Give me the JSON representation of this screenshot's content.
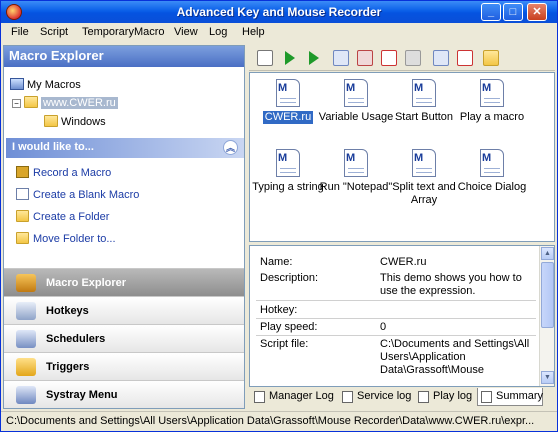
{
  "window": {
    "title": "Advanced Key and Mouse Recorder"
  },
  "menu": [
    "File",
    "Script",
    "TemporaryMacro",
    "View",
    "Log",
    "Help"
  ],
  "explorer": {
    "title": "Macro Explorer",
    "tree": {
      "root": "My Macros",
      "child": "www.CWER.ru",
      "grandchild": "Windows"
    }
  },
  "tasks": {
    "title": "I would like to...",
    "items": [
      "Record a Macro",
      "Create a Blank Macro",
      "Create a Folder",
      "Move Folder to..."
    ]
  },
  "nav": [
    "Macro Explorer",
    "Hotkeys",
    "Schedulers",
    "Triggers",
    "Systray Menu"
  ],
  "macros": [
    "CWER.ru",
    "Variable Usage",
    "Start Button",
    "Play a macro",
    "Typing a string",
    "Run \"Notepad\"",
    "Split text and Array",
    "Choice Dialog"
  ],
  "properties": {
    "name_label": "Name:",
    "name": "CWER.ru",
    "description_label": "Description:",
    "description": "This demo shows you how to use the expression.",
    "hotkey_label": "Hotkey:",
    "hotkey": "",
    "speed_label": "Play speed:",
    "speed": "0",
    "file_label": "Script file:",
    "file": "C:\\Documents and Settings\\All Users\\Application Data\\Grassoft\\Mouse"
  },
  "tabs": [
    "Manager Log",
    "Service log",
    "Play log",
    "Summary"
  ],
  "status": "C:\\Documents and Settings\\All Users\\Application Data\\Grassoft\\Mouse Recorder\\Data\\www.CWER.ru\\expr..."
}
